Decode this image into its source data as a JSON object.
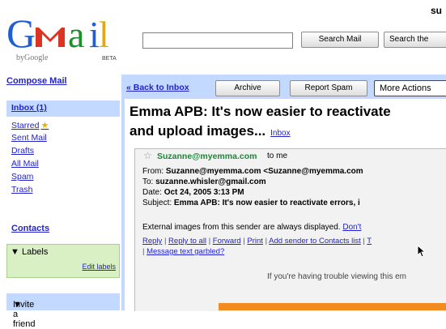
{
  "header": {
    "logo_text": "GMail",
    "logo_by": "byGoogle",
    "logo_beta": "BETA",
    "user": "su",
    "search_mail_label": "Search Mail",
    "search_web_label": "Search the"
  },
  "sidebar": {
    "compose": "Compose Mail",
    "items": [
      {
        "label": "Inbox (1)"
      },
      {
        "label": "Starred"
      },
      {
        "label": "Sent Mail"
      },
      {
        "label": "Drafts"
      },
      {
        "label": "All Mail"
      },
      {
        "label": "Spam"
      },
      {
        "label": "Trash"
      }
    ],
    "contacts": "Contacts",
    "labels_title": "Labels",
    "edit_labels": "Edit labels",
    "invite": "Invite a friend"
  },
  "toolbar": {
    "back": "« Back to Inbox",
    "archive": "Archive",
    "report_spam": "Report Spam",
    "more_actions": "More Actions"
  },
  "message": {
    "subject_line1": "Emma APB: It's now easier to reactivate",
    "subject_line2": "and upload images...",
    "inbox_tag": "Inbox",
    "sender": "Suzanne@myemma.com",
    "to_me": "to me",
    "from_label": "From:",
    "from_value": "Suzanne@myemma.com <Suzanne@myemma.com",
    "to_label": "To:",
    "to_value": "suzanne.whisler@gmail.com",
    "date_label": "Date:",
    "date_value": "Oct 24, 2005 3:13 PM",
    "subject_label": "Subject:",
    "subject_value": "Emma APB: It's now easier to reactivate errors, i",
    "external_note": "External images from this sender are always displayed.",
    "dont_link": "Don't",
    "actions": {
      "reply": "Reply",
      "reply_all": "Reply to all",
      "forward": "Forward",
      "print": "Print",
      "add_sender": "Add sender to Contacts list",
      "t": "T",
      "garbled": "Message text garbled?"
    },
    "trouble": "If you're having trouble viewing this em"
  },
  "colors": {
    "nav_bg": "#c3d9ff",
    "link": "#2222cc",
    "labels_bg": "#d8f0c4",
    "sender_green": "#178a34",
    "orange": "#f28c1e"
  }
}
